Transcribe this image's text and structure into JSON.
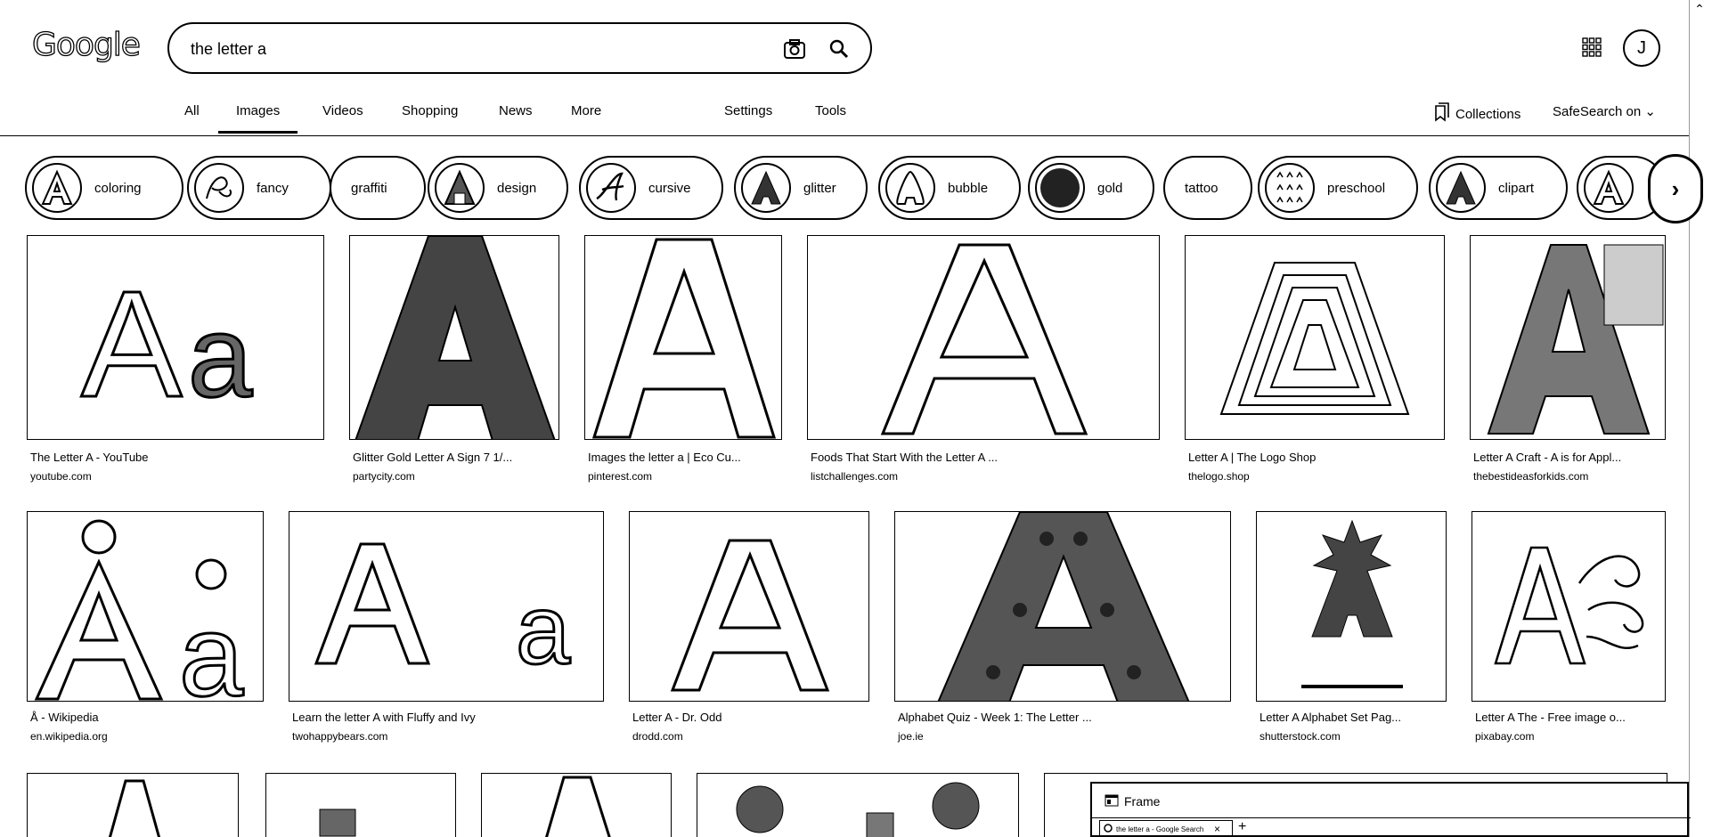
{
  "header": {
    "logo": "Google",
    "search_value": "the letter a",
    "avatar_letter": "J"
  },
  "tabs": [
    {
      "label": "All"
    },
    {
      "label": "Images"
    },
    {
      "label": "Videos"
    },
    {
      "label": "Shopping"
    },
    {
      "label": "News"
    },
    {
      "label": "More"
    },
    {
      "label": "Settings"
    },
    {
      "label": "Tools"
    }
  ],
  "toolbar": {
    "collections": "Collections",
    "safesearch": "SafeSearch on"
  },
  "chips": [
    {
      "label": "coloring"
    },
    {
      "label": "fancy"
    },
    {
      "label": "graffiti"
    },
    {
      "label": "design"
    },
    {
      "label": "cursive"
    },
    {
      "label": "glitter"
    },
    {
      "label": "bubble"
    },
    {
      "label": "gold"
    },
    {
      "label": "tattoo"
    },
    {
      "label": "preschool"
    },
    {
      "label": "clipart"
    }
  ],
  "results_row1": [
    {
      "title": "The Letter A - YouTube",
      "site": "youtube.com"
    },
    {
      "title": "Glitter Gold Letter A Sign 7 1/...",
      "site": "partycity.com"
    },
    {
      "title": "Images the letter a | Eco Cu...",
      "site": "pinterest.com"
    },
    {
      "title": "Foods That Start With the Letter A ...",
      "site": "listchallenges.com"
    },
    {
      "title": "Letter A | The Logo Shop",
      "site": "thelogo.shop"
    },
    {
      "title": "Letter A Craft - A is for Appl...",
      "site": "thebestideasforkids.com"
    }
  ],
  "results_row2": [
    {
      "title": "Å - Wikipedia",
      "site": "en.wikipedia.org"
    },
    {
      "title": "Learn the letter A with Fluffy and Ivy",
      "site": "twohappybears.com"
    },
    {
      "title": "Letter A - Dr. Odd",
      "site": "drodd.com"
    },
    {
      "title": "Alphabet Quiz - Week 1: The Letter ...",
      "site": "joe.ie"
    },
    {
      "title": "Letter A Alphabet Set Pag...",
      "site": "shutterstock.com"
    },
    {
      "title": "Letter A The - Free image o...",
      "site": "pixabay.com"
    }
  ],
  "frame": {
    "title": "Frame",
    "tab_label": "the letter a - Google Search"
  }
}
